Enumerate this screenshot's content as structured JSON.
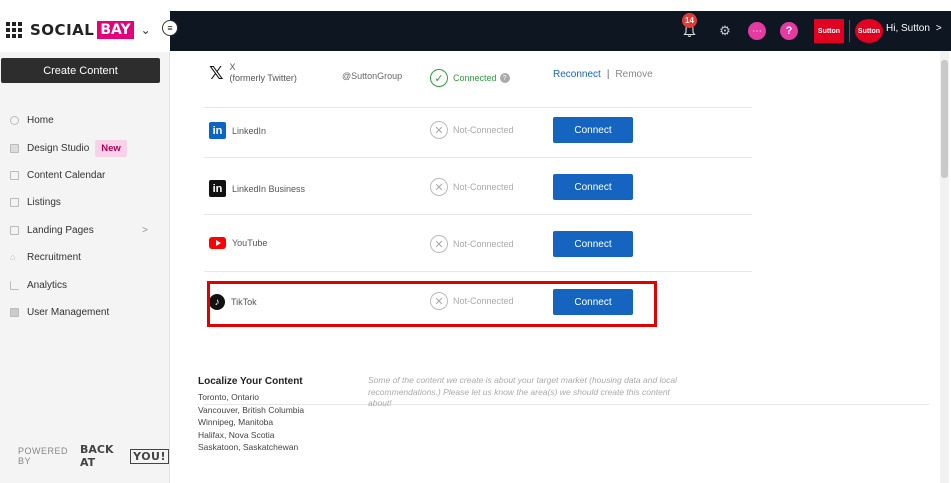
{
  "brand": {
    "social": "SOCIAL",
    "bay": "BAY",
    "colors": {
      "accent": "#e4007c"
    }
  },
  "sidebar": {
    "create_label": "Create Content",
    "items": [
      {
        "label": "Home",
        "icon": "home-icon"
      },
      {
        "label": "Design Studio",
        "icon": "design-icon",
        "badge": "New"
      },
      {
        "label": "Content Calendar",
        "icon": "calendar-icon"
      },
      {
        "label": "Listings",
        "icon": "listings-icon"
      },
      {
        "label": "Landing Pages",
        "icon": "page-icon",
        "arrow": ">"
      },
      {
        "label": "Recruitment",
        "icon": "recruitment-icon"
      },
      {
        "label": "Analytics",
        "icon": "analytics-icon"
      },
      {
        "label": "User Management",
        "icon": "users-icon"
      }
    ],
    "powered_by": {
      "prefix": "POWERED BY",
      "name": "BACK AT",
      "boxed": "YOU!"
    }
  },
  "topbar": {
    "notifications_count": "14",
    "logo_text": "Sutton",
    "avatar_text": "Sutton",
    "greeting": "Hi, Sutton",
    "greeting_arrow": ">"
  },
  "networks": [
    {
      "name": "X",
      "sub": "(formerly Twitter)",
      "logo": "x-logo-icon",
      "handle": "@SuttonGroup",
      "status": "Connected",
      "connected": true,
      "reconnect_label": "Reconnect",
      "separator": "|",
      "remove_label": "Remove"
    },
    {
      "name": "LinkedIn",
      "logo": "linkedin-logo-icon",
      "status": "Not-Connected",
      "connected": false,
      "action": "Connect"
    },
    {
      "name": "LinkedIn Business",
      "logo": "linkedin-business-logo-icon",
      "status": "Not-Connected",
      "connected": false,
      "action": "Connect"
    },
    {
      "name": "YouTube",
      "logo": "youtube-logo-icon",
      "status": "Not-Connected",
      "connected": false,
      "action": "Connect"
    },
    {
      "name": "TikTok",
      "logo": "tiktok-logo-icon",
      "status": "Not-Connected",
      "connected": false,
      "action": "Connect"
    }
  ],
  "localize": {
    "title": "Localize Your Content",
    "locations": [
      "Toronto, Ontario",
      "Vancouver, British Columbia",
      "Winnipeg, Manitoba",
      "Halifax, Nova Scotia",
      "Saskatoon, Saskatchewan"
    ],
    "note": "Some of the content we create is about your target market (housing data and local recommendations.) Please let us know the area(s) we should create this content about!"
  }
}
